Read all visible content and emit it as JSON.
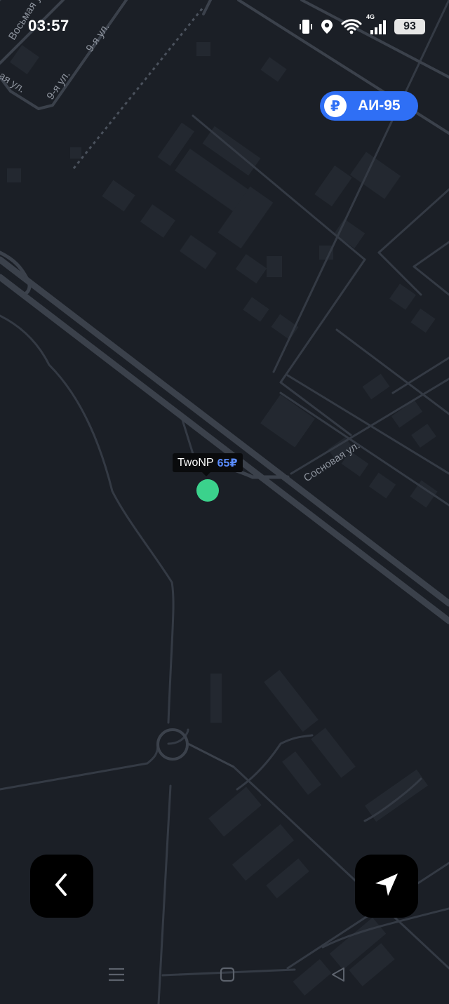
{
  "status_bar": {
    "time": "03:57",
    "battery": "93",
    "network": "4G",
    "icons": [
      "vibrate-icon",
      "location-icon",
      "wifi-icon",
      "signal-icon",
      "battery-icon"
    ]
  },
  "fuel_chip": {
    "currency_symbol": "₽",
    "label": "АИ-95",
    "color": "#2f6ff5"
  },
  "station": {
    "name": "TwoNP",
    "price": "65₽",
    "marker_color": "#3bd28c",
    "price_color": "#5a8cff"
  },
  "map": {
    "street_labels": {
      "vosmaya": "Восьмая ул.",
      "devyataya_top": "9-я ул.",
      "devyataya_left": "9-я ул.",
      "vtoraya": "Вторая ул.",
      "sosnovaya": "Сосновая ул."
    },
    "background_color": "#1b1f26"
  },
  "buttons": {
    "back_icon": "chevron-left-icon",
    "locate_icon": "navigation-arrow-icon"
  },
  "nav_bar": {
    "items": [
      "menu-icon",
      "home-icon",
      "back-triangle-icon"
    ]
  }
}
